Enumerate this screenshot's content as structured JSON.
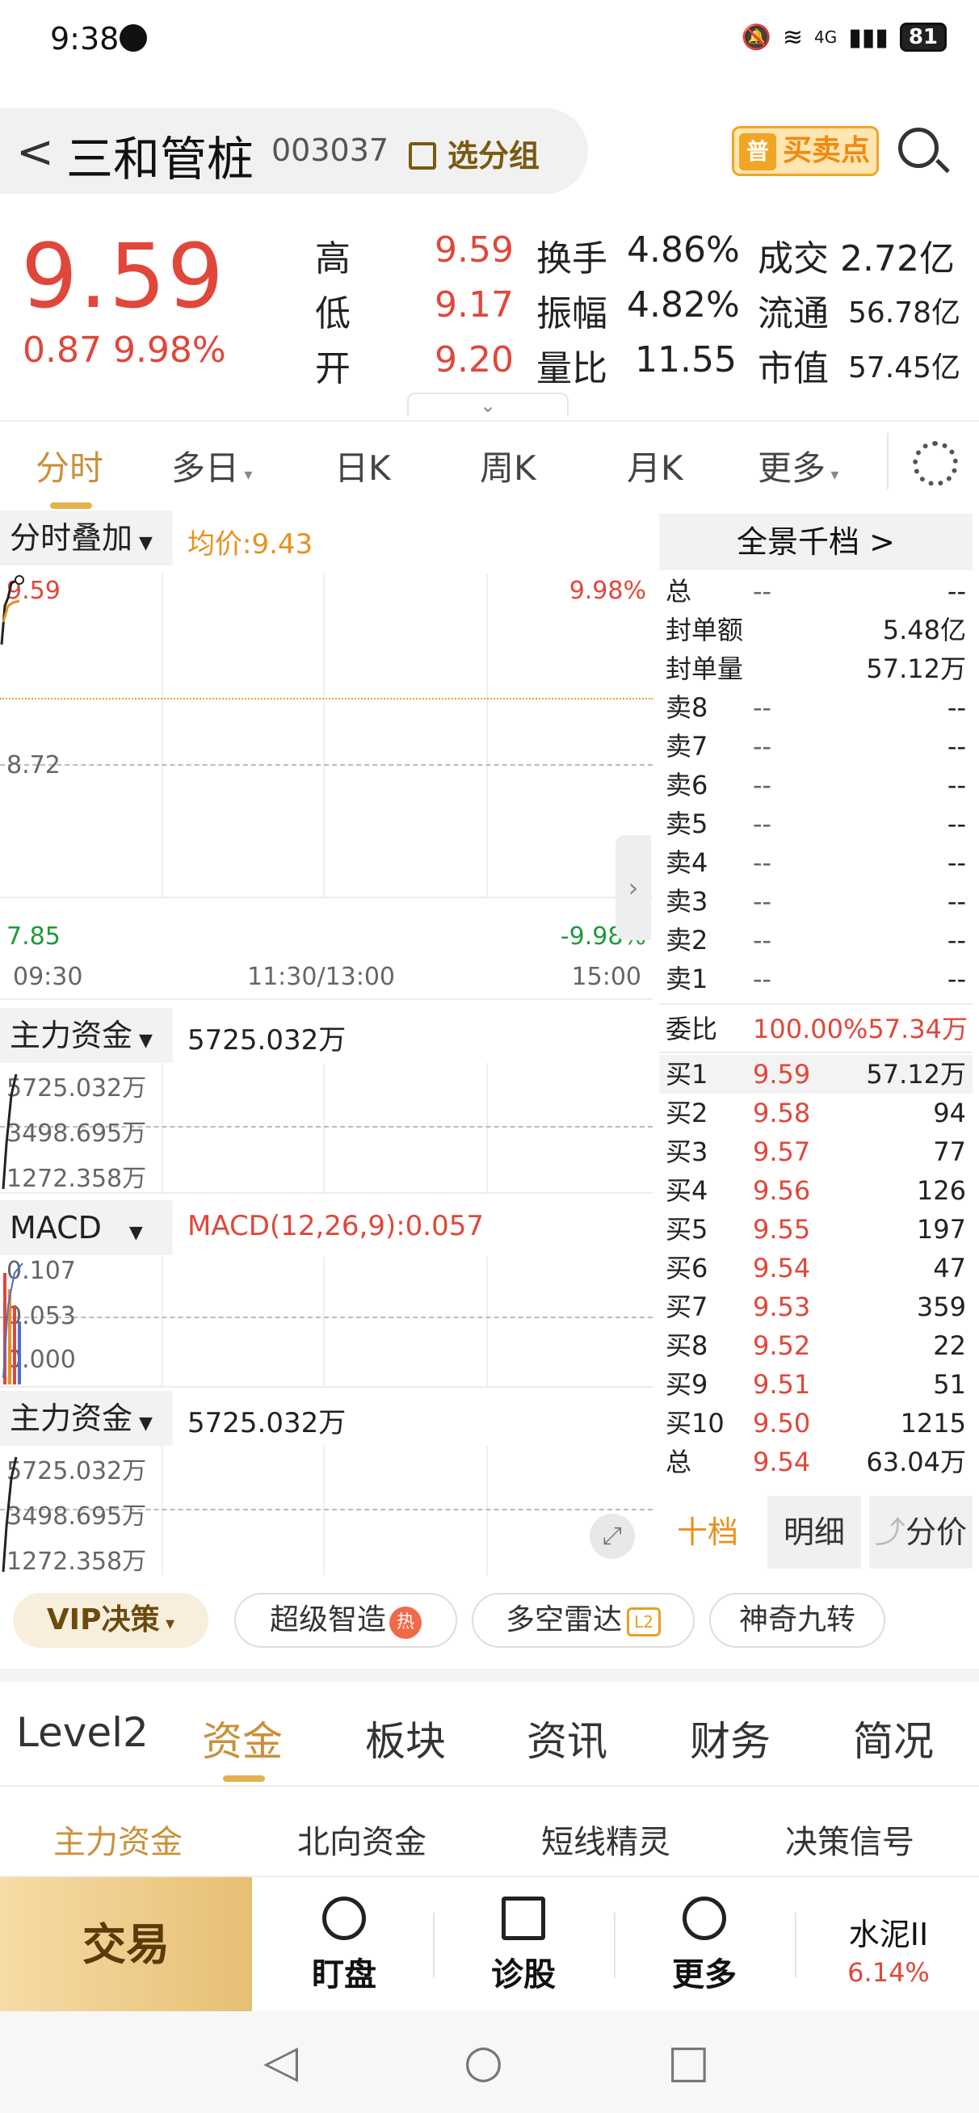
{
  "status": {
    "time": "9:38",
    "network": "4G",
    "battery": "81"
  },
  "header": {
    "back": "<",
    "name": "三和管桩",
    "code": "003037",
    "group_label": "选分组",
    "buy_sell_label": "买卖点",
    "buy_sell_badge": "普"
  },
  "quote": {
    "price": "9.59",
    "change": "0.87 9.98%",
    "rows": [
      {
        "l1": "高",
        "v1": "9.59",
        "l2": "换手",
        "v2": "4.86%",
        "l3": "成交",
        "v3": "2.72亿"
      },
      {
        "l1": "低",
        "v1": "9.17",
        "l2": "振幅",
        "v2": "4.82%",
        "l3": "流通",
        "v3": "56.78亿"
      },
      {
        "l1": "开",
        "v1": "9.20",
        "l2": "量比",
        "v2": "11.55",
        "l3": "市值",
        "v3": "57.45亿"
      }
    ]
  },
  "period_tabs": [
    "分时",
    "多日",
    "日K",
    "周K",
    "月K",
    "更多"
  ],
  "chart": {
    "overlay_label": "分时叠加",
    "avg_price": "均价:9.43",
    "y_top": "9.59",
    "y_mid": "8.72",
    "y_bottom": "7.85",
    "pct_top": "9.98%",
    "pct_bottom": "-9.98%",
    "x_labels": [
      "09:30",
      "11:30/13:00",
      "15:00"
    ],
    "fund1": {
      "label": "主力资金",
      "value": "5725.032万",
      "ticks": [
        "5725.032万",
        "3498.695万",
        "1272.358万"
      ]
    },
    "macd": {
      "label": "MACD",
      "value": "MACD(12,26,9):0.057",
      "ticks": [
        "0.107",
        "0.053",
        "0.000"
      ]
    },
    "fund2": {
      "label": "主力资金",
      "value": "5725.032万",
      "ticks": [
        "5725.032万",
        "3498.695万",
        "1272.358万"
      ]
    }
  },
  "book": {
    "header": "全景千档 >",
    "top": [
      {
        "l": "总",
        "p": "--",
        "v": "--"
      },
      {
        "l": "封单额",
        "p": "",
        "v": "5.48亿"
      },
      {
        "l": "封单量",
        "p": "",
        "v": "57.12万"
      }
    ],
    "sells": [
      {
        "l": "卖8",
        "p": "--",
        "v": "--"
      },
      {
        "l": "卖7",
        "p": "--",
        "v": "--"
      },
      {
        "l": "卖6",
        "p": "--",
        "v": "--"
      },
      {
        "l": "卖5",
        "p": "--",
        "v": "--"
      },
      {
        "l": "卖4",
        "p": "--",
        "v": "--"
      },
      {
        "l": "卖3",
        "p": "--",
        "v": "--"
      },
      {
        "l": "卖2",
        "p": "--",
        "v": "--"
      },
      {
        "l": "卖1",
        "p": "--",
        "v": "--"
      }
    ],
    "ratio": {
      "l": "委比",
      "p": "100.00%57.34万"
    },
    "buys": [
      {
        "l": "买1",
        "p": "9.59",
        "v": "57.12万"
      },
      {
        "l": "买2",
        "p": "9.58",
        "v": "94"
      },
      {
        "l": "买3",
        "p": "9.57",
        "v": "77"
      },
      {
        "l": "买4",
        "p": "9.56",
        "v": "126"
      },
      {
        "l": "买5",
        "p": "9.55",
        "v": "197"
      },
      {
        "l": "买6",
        "p": "9.54",
        "v": "47"
      },
      {
        "l": "买7",
        "p": "9.53",
        "v": "359"
      },
      {
        "l": "买8",
        "p": "9.52",
        "v": "22"
      },
      {
        "l": "买9",
        "p": "9.51",
        "v": "51"
      },
      {
        "l": "买10",
        "p": "9.50",
        "v": "1215"
      }
    ],
    "total": {
      "l": "总",
      "p": "9.54",
      "v": "63.04万"
    },
    "buttons": [
      "十档",
      "明细",
      "分价"
    ]
  },
  "chips": {
    "vip": "VIP决策",
    "c1": "超级智造",
    "c1_badge": "热",
    "c2": "多空雷达",
    "c2_badge": "L2",
    "c3": "神奇九转"
  },
  "info_tabs": [
    "Level2",
    "资金",
    "板块",
    "资讯",
    "财务",
    "简况"
  ],
  "sub_tabs": [
    "主力资金",
    "北向资金",
    "短线精灵",
    "决策信号"
  ],
  "bottom": {
    "trade": "交易",
    "items": [
      "盯盘",
      "诊股",
      "更多"
    ],
    "sector_name": "水泥II",
    "sector_pct": "6.14%"
  },
  "colors": {
    "up": "#e0473a",
    "down": "#1f9a3a",
    "accent": "#c8913a",
    "avg": "#e8901c"
  }
}
